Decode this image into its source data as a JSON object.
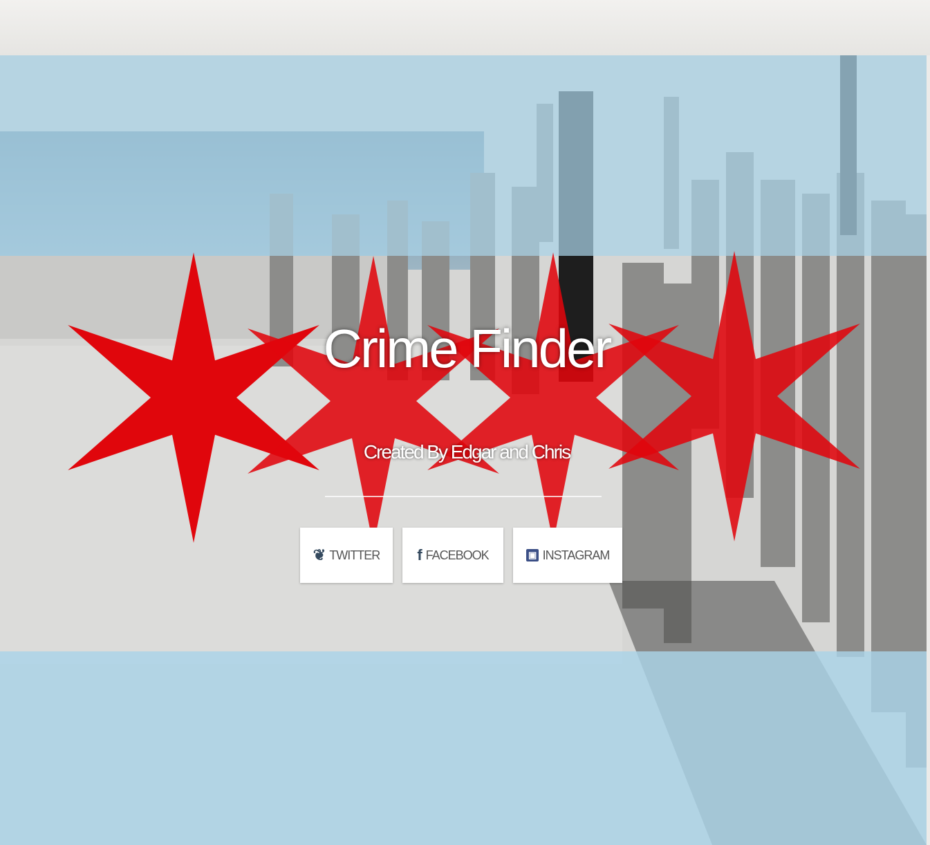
{
  "hero": {
    "title": "Crime Finder",
    "subtitle": "Created By Edgar and Chris"
  },
  "social": [
    {
      "label": "TWITTER",
      "icon": "twitter-icon"
    },
    {
      "label": "FACEBOOK",
      "icon": "facebook-icon"
    },
    {
      "label": "INSTAGRAM",
      "icon": "instagram-icon"
    }
  ],
  "colors": {
    "flag_blue": "#a9d3e8",
    "flag_red": "#e0060c",
    "background": "#ecebe9"
  }
}
